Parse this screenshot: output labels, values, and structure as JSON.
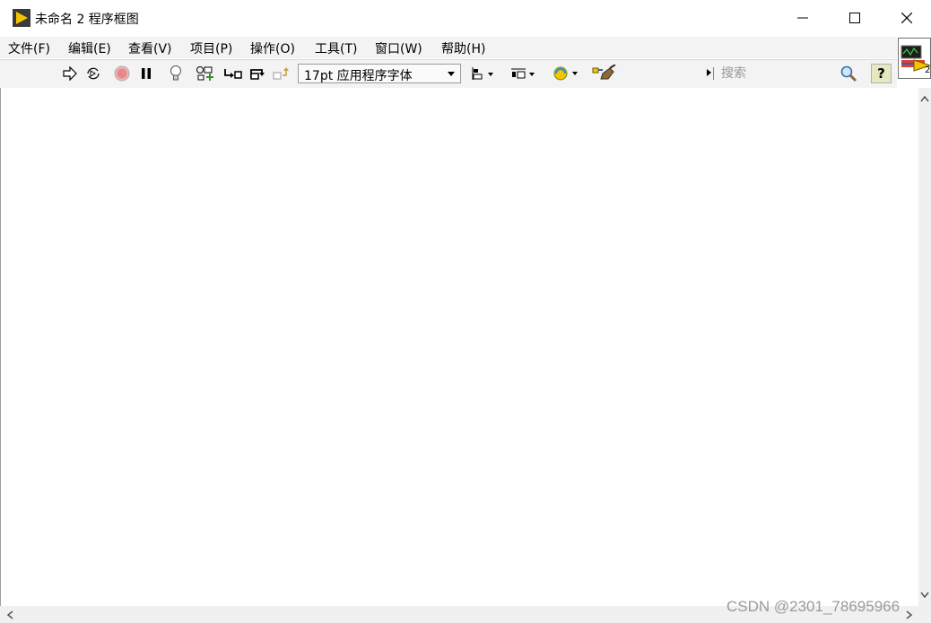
{
  "window": {
    "title": "未命名 2 程序框图"
  },
  "menu": {
    "items": [
      "文件(F)",
      "编辑(E)",
      "查看(V)",
      "项目(P)",
      "操作(O)",
      "工具(T)",
      "窗口(W)",
      "帮助(H)"
    ]
  },
  "toolbar": {
    "font_value": "17pt 应用程序字体",
    "search_placeholder": "搜索",
    "help_label": "?"
  },
  "vi_icon": {
    "label": "2"
  },
  "watermark": "CSDN @2301_78695966",
  "colors": {
    "accent": "#f5c400",
    "toolbar_bg": "#f3f3f3",
    "canvas_bg": "#ffffff"
  }
}
